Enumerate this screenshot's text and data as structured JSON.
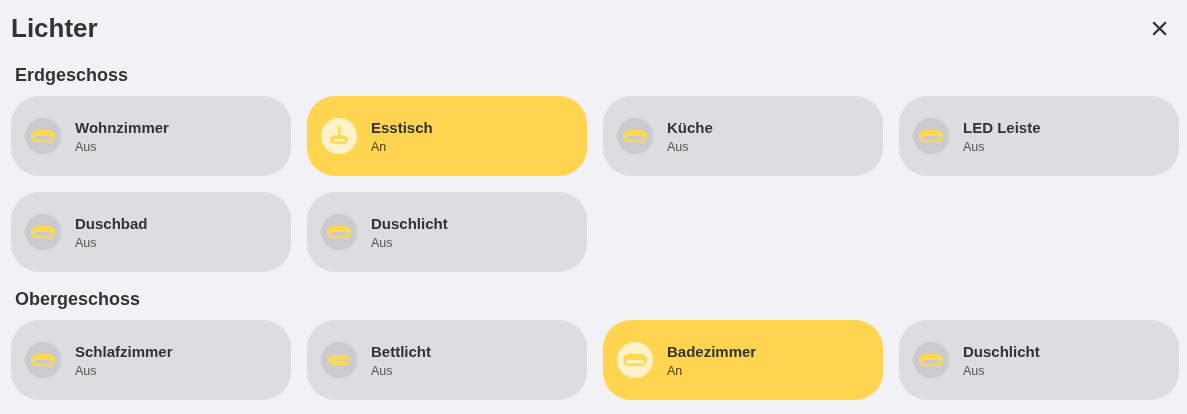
{
  "title": "Lichter",
  "close": "×",
  "sections": [
    {
      "name": "Erdgeschoss",
      "lights": [
        {
          "name": "Wohnzimmer",
          "state": "Aus",
          "on": false,
          "kind": "ceiling"
        },
        {
          "name": "Esstisch",
          "state": "An",
          "on": true,
          "kind": "pendant"
        },
        {
          "name": "Küche",
          "state": "Aus",
          "on": false,
          "kind": "ceiling"
        },
        {
          "name": "LED Leiste",
          "state": "Aus",
          "on": false,
          "kind": "ceiling"
        },
        {
          "name": "Duschbad",
          "state": "Aus",
          "on": false,
          "kind": "ceiling"
        },
        {
          "name": "Duschlicht",
          "state": "Aus",
          "on": false,
          "kind": "ceiling"
        }
      ]
    },
    {
      "name": "Obergeschoss",
      "lights": [
        {
          "name": "Schlafzimmer",
          "state": "Aus",
          "on": false,
          "kind": "ceiling"
        },
        {
          "name": "Bettlicht",
          "state": "Aus",
          "on": false,
          "kind": "strip"
        },
        {
          "name": "Badezimmer",
          "state": "An",
          "on": true,
          "kind": "ceiling"
        },
        {
          "name": "Duschlicht",
          "state": "Aus",
          "on": false,
          "kind": "ceiling"
        }
      ]
    }
  ]
}
